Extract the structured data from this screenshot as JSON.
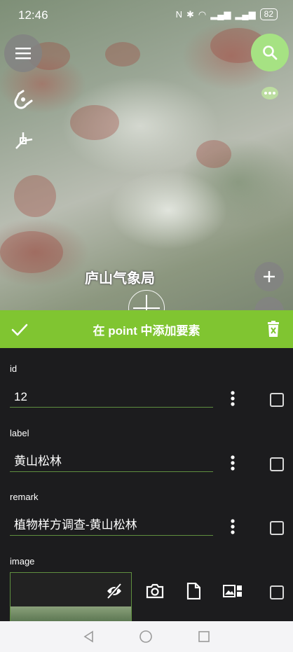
{
  "status_bar": {
    "time": "12:46",
    "battery": "82"
  },
  "map": {
    "place_label": "庐山气象局",
    "controls": {
      "menu_icon": "hamburger-menu-icon",
      "search_icon": "search-icon",
      "chat_icon": "chat-bubble-icon",
      "snap_icon": "magnet-snap-icon",
      "vertex_icon": "vertex-tool-icon",
      "zoom_in_icon": "plus-icon",
      "crosshair_icon": "crosshair-icon"
    }
  },
  "form_header": {
    "title": "在 point 中添加要素",
    "confirm_icon": "check-icon",
    "delete_icon": "delete-icon",
    "accent_color": "#80c531"
  },
  "fields": [
    {
      "label": "id",
      "value": "12"
    },
    {
      "label": "label",
      "value": "黄山松林"
    },
    {
      "label": "remark",
      "value": "植物样方调查-黄山松林"
    }
  ],
  "image_field": {
    "label": "image",
    "hide_icon": "eye-off-icon",
    "actions": [
      "camera-icon",
      "file-icon",
      "gallery-icon"
    ]
  },
  "nav_bar": {
    "back_icon": "back-triangle-icon",
    "home_icon": "home-circle-icon",
    "recents_icon": "recents-square-icon"
  }
}
